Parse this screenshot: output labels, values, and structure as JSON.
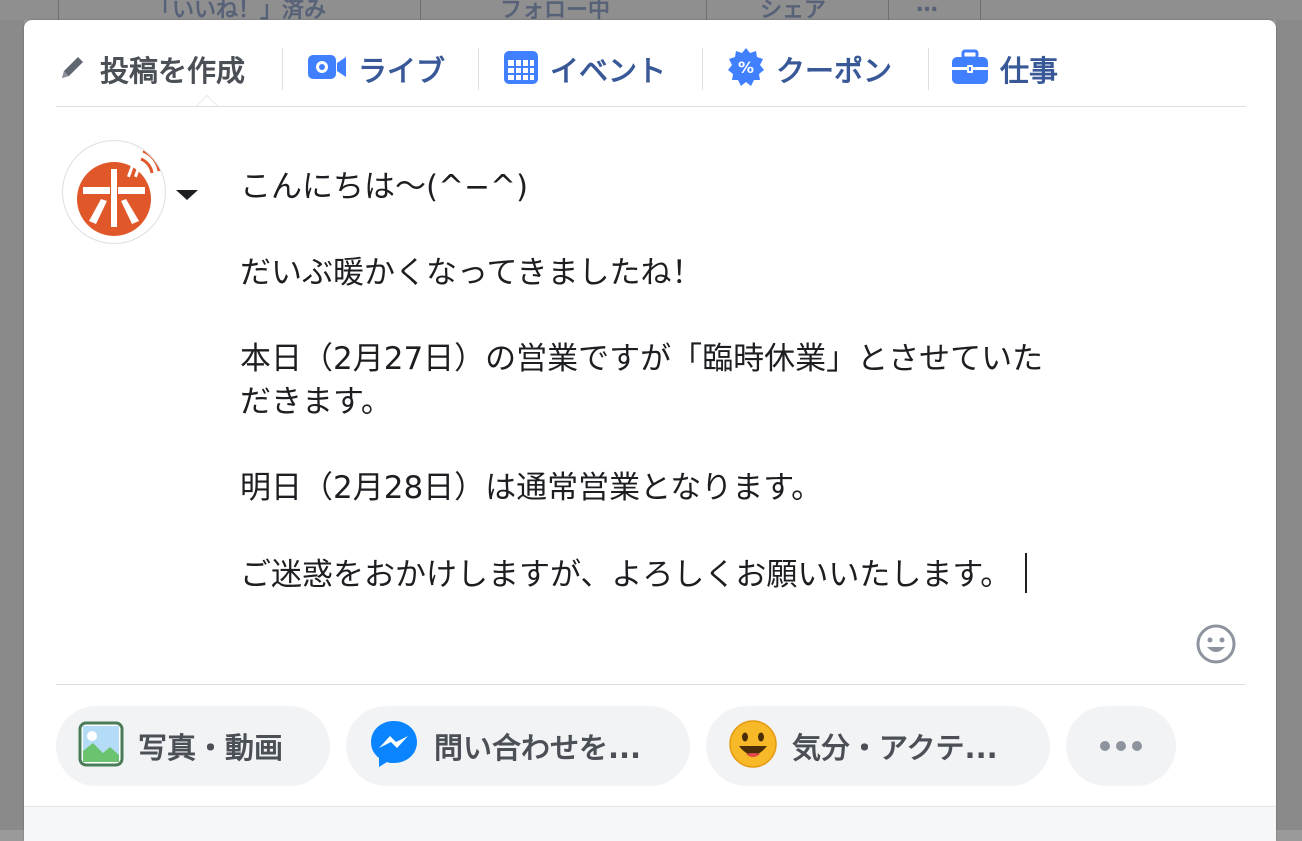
{
  "background": {
    "tabs": [
      {
        "label": "「いいね！」済み"
      },
      {
        "label": "フォロー中"
      },
      {
        "label": "シェア"
      },
      {
        "label": "…"
      }
    ]
  },
  "composer": {
    "tabs": [
      {
        "label": "投稿を作成",
        "icon": "pencil-icon"
      },
      {
        "label": "ライブ",
        "icon": "video-camera-icon"
      },
      {
        "label": "イベント",
        "icon": "calendar-icon"
      },
      {
        "label": "クーポン",
        "icon": "percent-badge-icon"
      },
      {
        "label": "仕事",
        "icon": "briefcase-icon"
      }
    ],
    "avatar": {
      "char": "ボ",
      "color": "#e0582a"
    },
    "post_lines": [
      "こんにちは〜(^−^)",
      "だいぶ暖かくなってきましたね！",
      "本日（2月27日）の営業ですが「臨時休業」とさせていた",
      "だきます。",
      "明日（2月28日）は通常営業となります。",
      "ご迷惑をおかけしますが、よろしくお願いいたします。"
    ],
    "actions": [
      {
        "label": "写真・動画",
        "icon": "photo-icon"
      },
      {
        "label": "問い合わせを...",
        "icon": "messenger-icon"
      },
      {
        "label": "気分・アクテ...",
        "icon": "smiley-emoji-icon"
      },
      {
        "label": "•••",
        "icon": "more-icon"
      }
    ],
    "colors": {
      "accent": "#385898",
      "icon_blue": "#4080ff",
      "pill_bg": "#f2f3f5"
    }
  }
}
